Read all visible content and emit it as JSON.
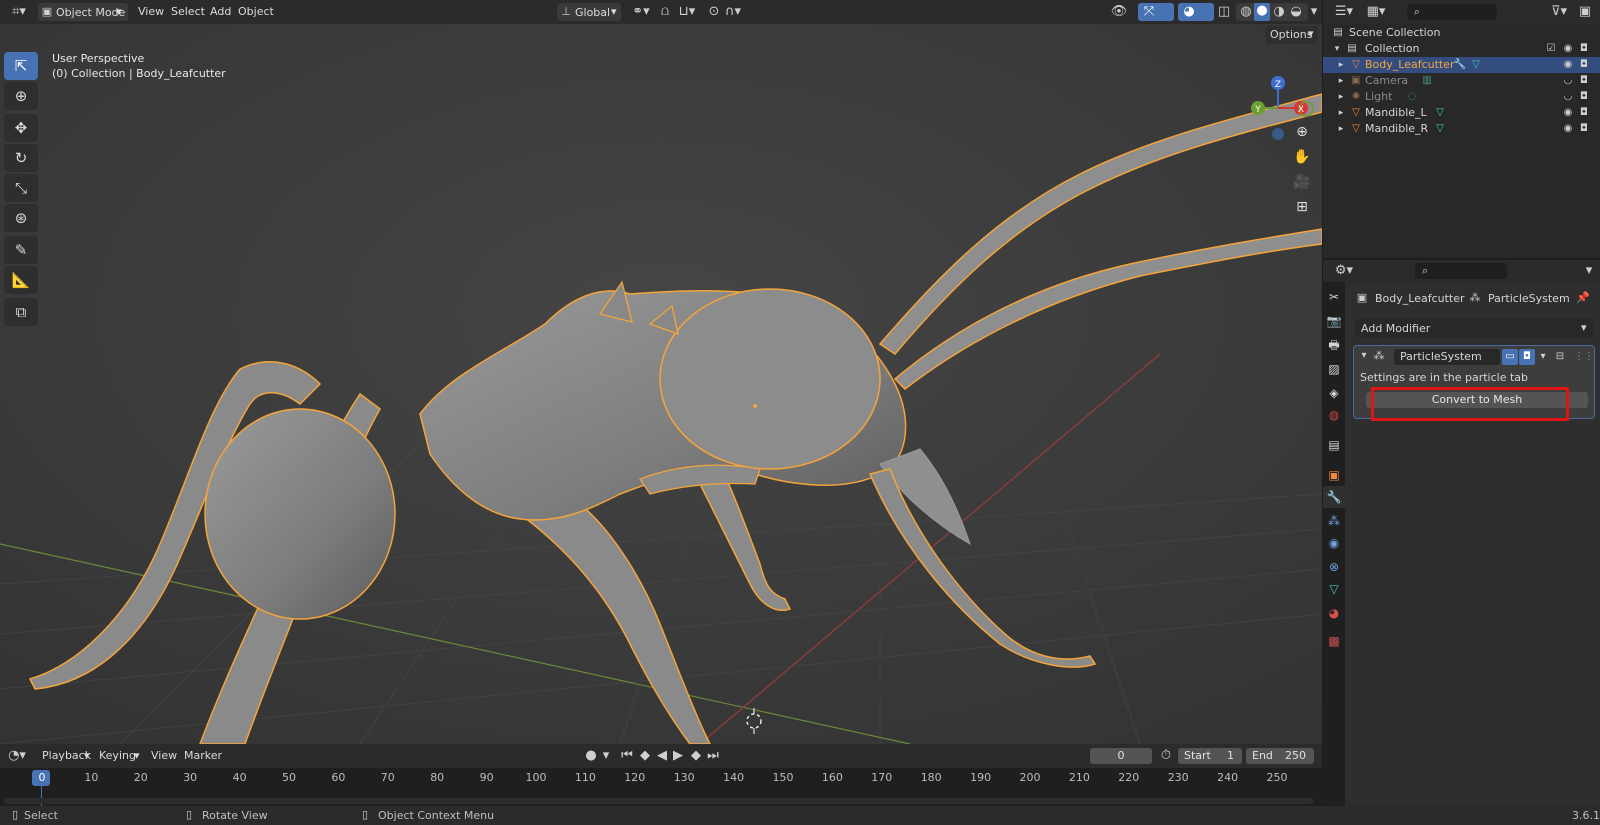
{
  "header": {
    "editor_type_icon": "editor-type-icon",
    "mode": "Object Mode",
    "menus": [
      "View",
      "Select",
      "Add",
      "Object"
    ],
    "orientation": "Global",
    "options_label": "Options"
  },
  "viewport": {
    "perspective_label": "User Perspective",
    "collection_label": "(0) Collection | Body_Leafcutter",
    "gizmo_axes": {
      "z": "Z",
      "y": "Y",
      "x": "X"
    }
  },
  "tools": [
    "select-box-icon",
    "cursor-icon",
    "move-icon",
    "rotate-icon",
    "scale-icon",
    "transform-icon",
    "annotate-icon",
    "measure-icon",
    "add-cube-icon"
  ],
  "outliner": {
    "root": "Scene Collection",
    "collection": "Collection",
    "items": [
      {
        "name": "Body_Leafcutter",
        "selected": true
      },
      {
        "name": "Camera",
        "selected": false
      },
      {
        "name": "Light",
        "selected": false
      },
      {
        "name": "Mandible_L",
        "selected": false
      },
      {
        "name": "Mandible_R",
        "selected": false
      }
    ]
  },
  "properties": {
    "breadcrumb_object": "Body_Leafcutter",
    "breadcrumb_sep": "›",
    "breadcrumb_modifier": "ParticleSystem",
    "add_modifier": "Add Modifier",
    "modifier_name": "ParticleSystem",
    "info_text": "Settings are in the particle tab",
    "convert_button": "Convert to Mesh"
  },
  "timeline": {
    "menus": [
      "Playback",
      "Keying",
      "View",
      "Marker"
    ],
    "current_frame": "0",
    "start_label": "Start",
    "start_value": "1",
    "end_label": "End",
    "end_value": "250",
    "ruler": [
      "0",
      "10",
      "20",
      "30",
      "40",
      "50",
      "60",
      "70",
      "80",
      "90",
      "100",
      "110",
      "120",
      "130",
      "140",
      "150",
      "160",
      "170",
      "180",
      "190",
      "200",
      "210",
      "220",
      "230",
      "240",
      "250"
    ]
  },
  "statusbar": {
    "select": "Select",
    "rotate": "Rotate View",
    "context": "Object Context Menu",
    "version": "3.6.1"
  },
  "colors": {
    "selection_outline": "#f5a43a",
    "active_blue": "#4772b3",
    "highlight_red": "#e11414"
  }
}
